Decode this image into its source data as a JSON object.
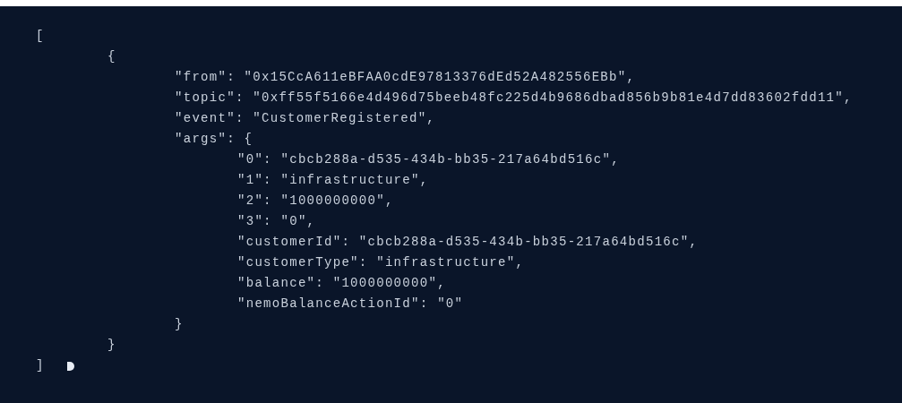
{
  "code_view": {
    "text": "[",
    "close": "]",
    "children": [
      {
        "text": "{",
        "close": "}",
        "children": [
          {
            "text": "\"from\": \"0x15CcA611eBFAA0cdE97813376dEd52A482556EBb\","
          },
          {
            "text": "\"topic\": \"0xff55f5166e4d496d75beeb48fc225d4b9686dbad856b9b81e4d7dd83602fdd11\","
          },
          {
            "text": "\"event\": \"CustomerRegistered\","
          },
          {
            "text": "\"args\": {",
            "close": "}",
            "children": [
              {
                "text": "\"0\": \"cbcb288a-d535-434b-bb35-217a64bd516c\","
              },
              {
                "text": "\"1\": \"infrastructure\","
              },
              {
                "text": "\"2\": \"1000000000\","
              },
              {
                "text": "\"3\": \"0\","
              },
              {
                "text": "\"customerId\": \"cbcb288a-d535-434b-bb35-217a64bd516c\","
              },
              {
                "text": "\"customerType\": \"infrastructure\","
              },
              {
                "text": "\"balance\": \"1000000000\","
              },
              {
                "text": "\"nemoBalanceActionId\": \"0\""
              }
            ]
          }
        ]
      }
    ]
  }
}
